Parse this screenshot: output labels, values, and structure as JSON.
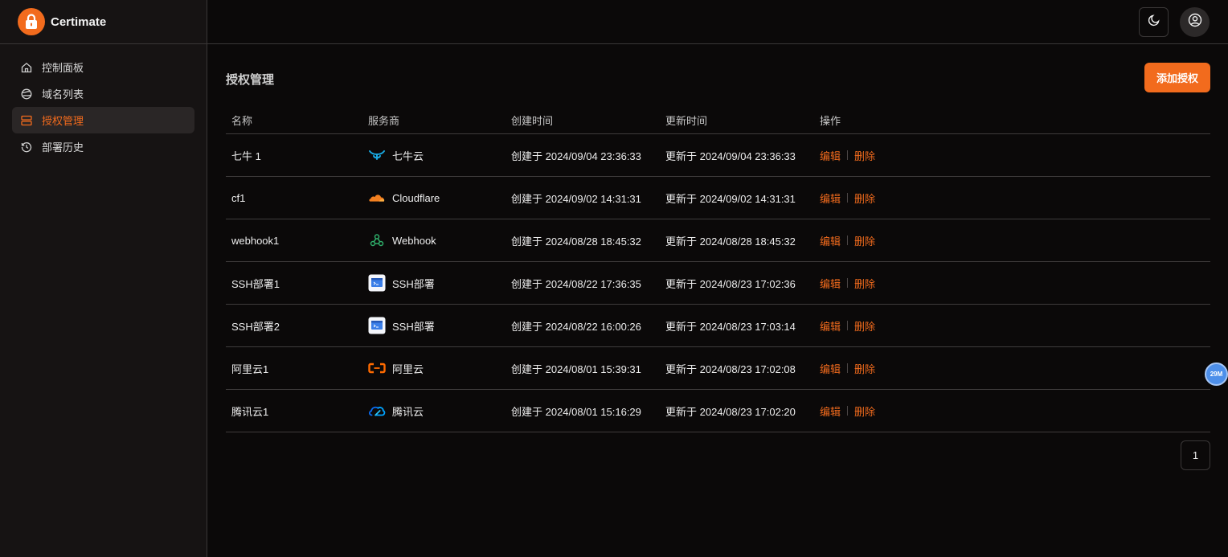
{
  "app": {
    "name": "Certimate"
  },
  "sidebar": {
    "items": [
      {
        "label": "控制面板",
        "icon": "home-icon"
      },
      {
        "label": "域名列表",
        "icon": "globe-icon"
      },
      {
        "label": "授权管理",
        "icon": "server-icon",
        "active": true
      },
      {
        "label": "部署历史",
        "icon": "history-icon"
      }
    ]
  },
  "header": {
    "theme_icon": "moon-icon",
    "user_icon": "user-circle-icon"
  },
  "page": {
    "title": "授权管理",
    "add_button": "添加授权"
  },
  "table": {
    "columns": [
      "名称",
      "服务商",
      "创建时间",
      "更新时间",
      "操作"
    ],
    "rows": [
      {
        "name": "七牛 1",
        "provider": "七牛云",
        "provider_icon": "qiniu-icon",
        "created": "创建于 2024/09/04 23:36:33",
        "updated": "更新于 2024/09/04 23:36:33"
      },
      {
        "name": "cf1",
        "provider": "Cloudflare",
        "provider_icon": "cloudflare-icon",
        "created": "创建于 2024/09/02 14:31:31",
        "updated": "更新于 2024/09/02 14:31:31"
      },
      {
        "name": "webhook1",
        "provider": "Webhook",
        "provider_icon": "webhook-icon",
        "created": "创建于 2024/08/28 18:45:32",
        "updated": "更新于 2024/08/28 18:45:32"
      },
      {
        "name": "SSH部署1",
        "provider": "SSH部署",
        "provider_icon": "ssh-icon",
        "created": "创建于 2024/08/22 17:36:35",
        "updated": "更新于 2024/08/23 17:02:36"
      },
      {
        "name": "SSH部署2",
        "provider": "SSH部署",
        "provider_icon": "ssh-icon",
        "created": "创建于 2024/08/22 16:00:26",
        "updated": "更新于 2024/08/23 17:03:14"
      },
      {
        "name": "阿里云1",
        "provider": "阿里云",
        "provider_icon": "aliyun-icon",
        "created": "创建于 2024/08/01 15:39:31",
        "updated": "更新于 2024/08/23 17:02:08"
      },
      {
        "name": "腾讯云1",
        "provider": "腾讯云",
        "provider_icon": "tencent-cloud-icon",
        "created": "创建于 2024/08/01 15:16:29",
        "updated": "更新于 2024/08/23 17:02:20"
      }
    ],
    "edit_label": "编辑",
    "delete_label": "删除"
  },
  "pagination": {
    "current": "1"
  },
  "badge": {
    "text": "29M"
  },
  "colors": {
    "accent": "#f26b1d",
    "background": "#0b0909",
    "sidebar": "#161313"
  }
}
